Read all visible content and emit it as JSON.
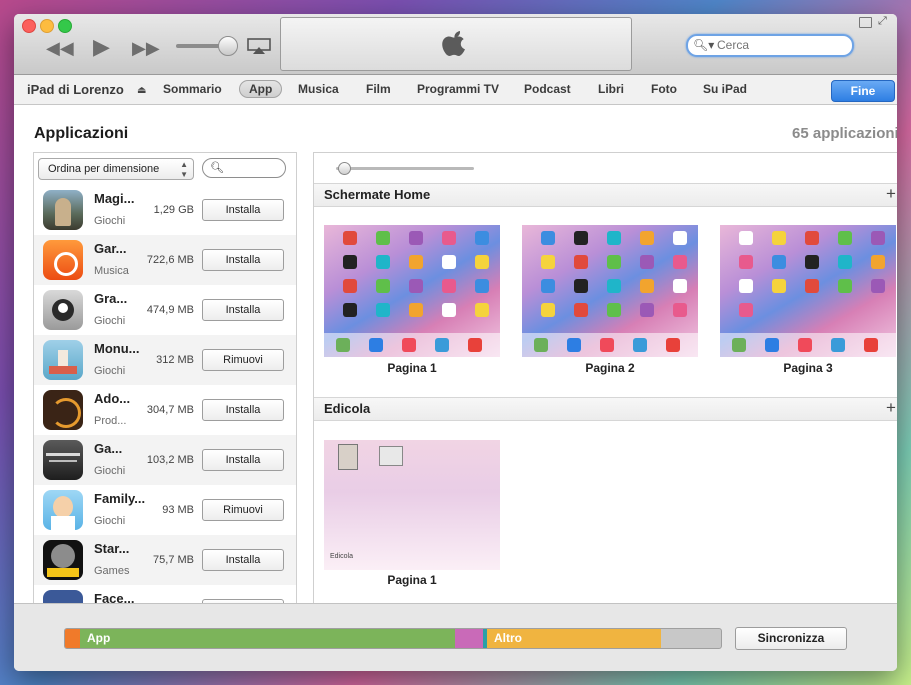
{
  "toolbar": {
    "search_placeholder": "Cerca",
    "transport_prev_icon": "rewind-icon",
    "transport_play_icon": "play-icon",
    "transport_next_icon": "fast-forward-icon"
  },
  "navbar": {
    "device_name": "iPad di Lorenzo",
    "eject_icon": "eject-icon",
    "tabs": [
      "Sommario",
      "App",
      "Musica",
      "Film",
      "Programmi TV",
      "Podcast",
      "Libri",
      "Foto",
      "Su iPad"
    ],
    "active_tab": "App",
    "done_label": "Fine"
  },
  "main": {
    "title": "Applicazioni",
    "count": "65 applicazioni"
  },
  "app_list": {
    "sort_label": "Ordina per dimensione",
    "apps": [
      {
        "name": "Magi...",
        "category": "Giochi",
        "size": "1,29 GB",
        "action": "Installa"
      },
      {
        "name": "Gar...",
        "category": "Musica",
        "size": "722,6 MB",
        "action": "Installa"
      },
      {
        "name": "Gra...",
        "category": "Giochi",
        "size": "474,9 MB",
        "action": "Installa"
      },
      {
        "name": "Monu...",
        "category": "Giochi",
        "size": "312 MB",
        "action": "Rimuovi"
      },
      {
        "name": "Ado...",
        "category": "Prod...",
        "size": "304,7 MB",
        "action": "Installa"
      },
      {
        "name": "Ga...",
        "category": "Giochi",
        "size": "103,2 MB",
        "action": "Installa"
      },
      {
        "name": "Family...",
        "category": "Giochi",
        "size": "93 MB",
        "action": "Rimuovi"
      },
      {
        "name": "Star...",
        "category": "Games",
        "size": "75,7 MB",
        "action": "Installa"
      },
      {
        "name": "Face...",
        "category": "",
        "size": "",
        "action": ""
      }
    ]
  },
  "home_screens": {
    "section_title": "Schermate Home",
    "pages": [
      "Pagina 1",
      "Pagina 2",
      "Pagina 3"
    ]
  },
  "newsstand": {
    "section_title": "Edicola",
    "inner_label": "Edicola",
    "pages": [
      "Pagina 1"
    ]
  },
  "capacity": {
    "app_label": "App",
    "other_label": "Altro",
    "colors": {
      "app": "#7cb45a",
      "other": "#f0b440",
      "audio": "#f07a2a",
      "photo": "#c96ab8",
      "free": "#c8c8c8"
    }
  },
  "sync_label": "Sincronizza"
}
